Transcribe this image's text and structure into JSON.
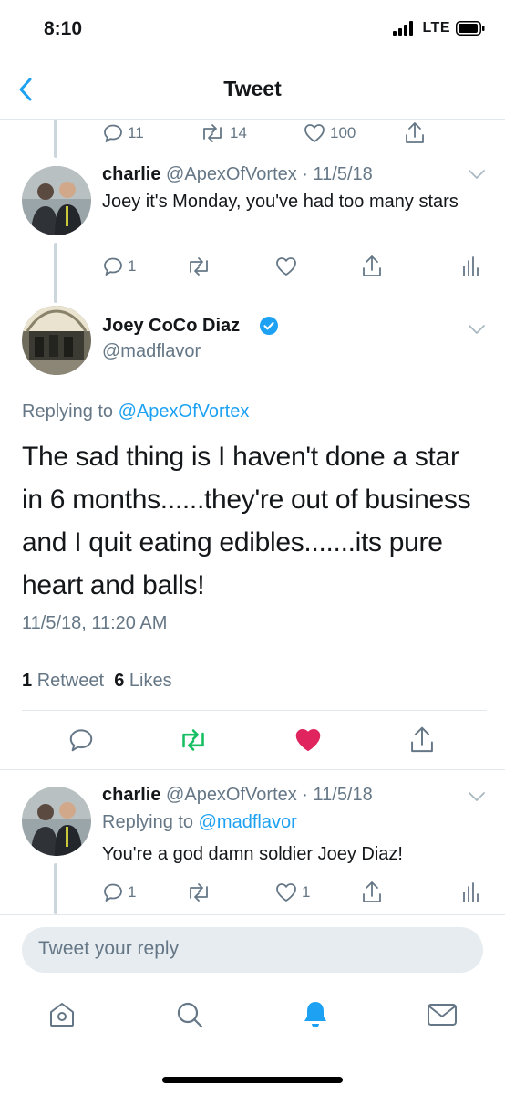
{
  "status": {
    "time": "8:10",
    "network": "LTE"
  },
  "nav": {
    "title": "Tweet"
  },
  "parent_tweet_actions": {
    "replies": "11",
    "retweets": "14",
    "likes": "100"
  },
  "charlie_tweet": {
    "name": "charlie",
    "handle": "@ApexOfVortex",
    "date": "11/5/18",
    "text": "Joey it's Monday, you've had too many stars",
    "replies": "1"
  },
  "main_tweet": {
    "name": "Joey CoCo Diaz",
    "handle": "@madflavor",
    "replying_prefix": "Replying to",
    "replying_handle": "@ApexOfVortex",
    "text": "The sad thing is I haven't done a star in 6 months......they're out of business and I quit eating edibles.......its pure heart and balls!",
    "timestamp": "11/5/18, 11:20 AM",
    "retweet_count": "1",
    "retweet_label": "Retweet",
    "like_count": "6",
    "like_label": "Likes"
  },
  "reply_tweet": {
    "name": "charlie",
    "handle": "@ApexOfVortex",
    "date": "11/5/18",
    "replying_prefix": "Replying to",
    "replying_handle": "@madflavor",
    "text": "You're a god damn soldier Joey Diaz!",
    "replies": "1",
    "likes": "1"
  },
  "composer": {
    "placeholder": "Tweet your reply"
  },
  "colors": {
    "accent": "#1da1f2",
    "like": "#e0245e",
    "retweet": "#17bf63",
    "gray": "#657786"
  },
  "tab_bar": {
    "icons": [
      "home-icon",
      "search-icon",
      "notifications-icon",
      "messages-icon"
    ],
    "active": "notifications-icon"
  }
}
